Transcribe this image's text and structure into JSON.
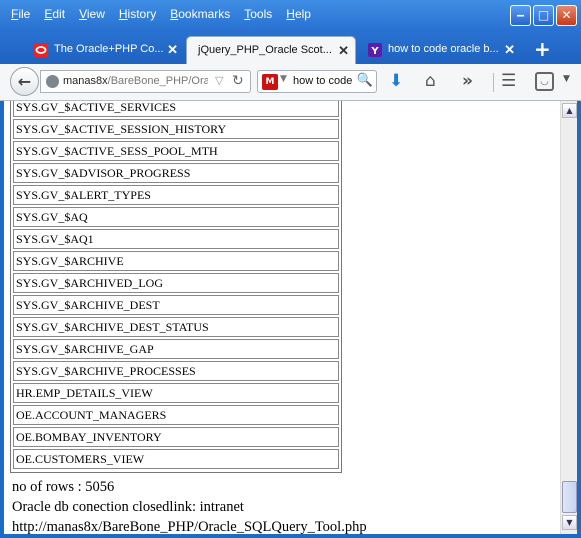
{
  "menubar": [
    {
      "label": "File",
      "u": "F",
      "rest": "ile"
    },
    {
      "label": "Edit",
      "u": "E",
      "rest": "dit"
    },
    {
      "label": "View",
      "u": "V",
      "rest": "iew"
    },
    {
      "label": "History",
      "u": "H",
      "rest": "istory"
    },
    {
      "label": "Bookmarks",
      "u": "B",
      "rest": "ookmarks"
    },
    {
      "label": "Tools",
      "u": "T",
      "rest": "ools"
    },
    {
      "label": "Help",
      "u": "H",
      "rest": "elp"
    }
  ],
  "tabs": [
    {
      "title": "The Oracle+PHP Co...",
      "icon": "oracle-icon"
    },
    {
      "title": "jQuery_PHP_Oracle Scot...",
      "icon": "none"
    },
    {
      "title": "how to code oracle b...",
      "icon": "yahoo-icon"
    }
  ],
  "nav": {
    "url_host": "manas8x",
    "url_path": "/BareBone_PHP/Oracl",
    "search_text": "how to code",
    "search_engine": "McAfee"
  },
  "rows": [
    "SYS.GV_$ACTIVE_SERVICES",
    "SYS.GV_$ACTIVE_SESSION_HISTORY",
    "SYS.GV_$ACTIVE_SESS_POOL_MTH",
    "SYS.GV_$ADVISOR_PROGRESS",
    "SYS.GV_$ALERT_TYPES",
    "SYS.GV_$AQ",
    "SYS.GV_$AQ1",
    "SYS.GV_$ARCHIVE",
    "SYS.GV_$ARCHIVED_LOG",
    "SYS.GV_$ARCHIVE_DEST",
    "SYS.GV_$ARCHIVE_DEST_STATUS",
    "SYS.GV_$ARCHIVE_GAP",
    "SYS.GV_$ARCHIVE_PROCESSES",
    "HR.EMP_DETAILS_VIEW",
    "OE.ACCOUNT_MANAGERS",
    "OE.BOMBAY_INVENTORY",
    "OE.CUSTOMERS_VIEW"
  ],
  "footer": {
    "rows_count": "no of rows : 5056",
    "status_line": "Oracle db conection closedlink: intranet http://manas8x/BareBone_PHP/Oracle_SQLQuery_Tool.php"
  },
  "colors": {
    "titlebar": "#2a73d2",
    "toolbar": "#f5f6f7"
  }
}
